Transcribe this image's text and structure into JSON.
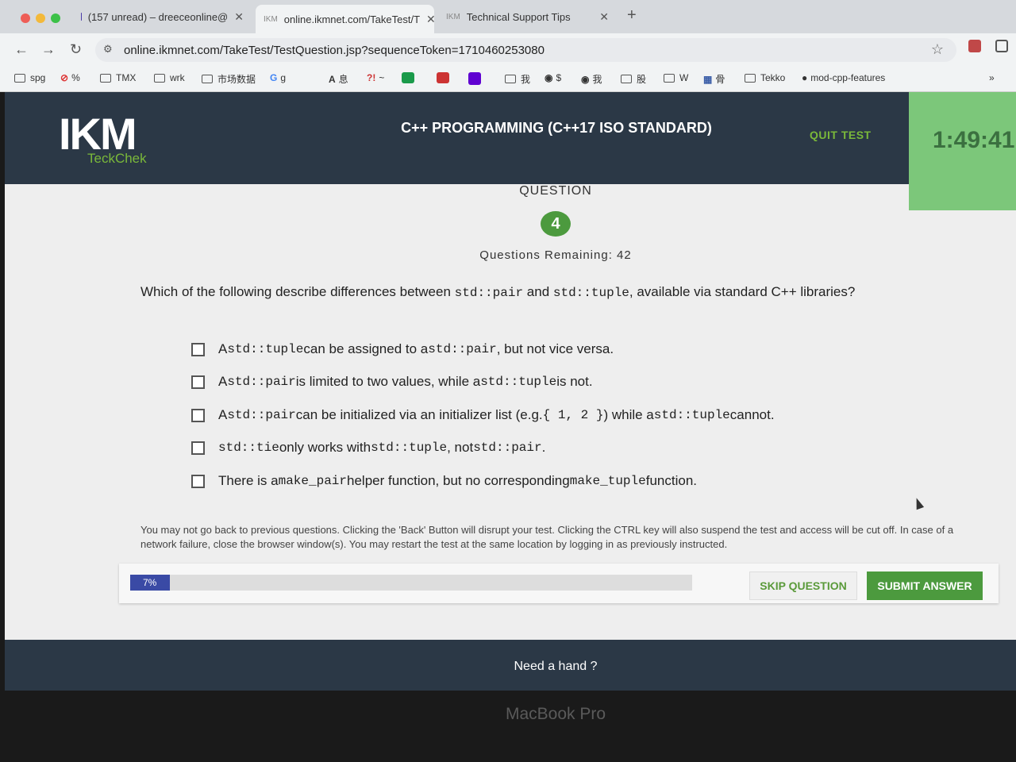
{
  "browser": {
    "tabs": [
      {
        "label": "(157 unread) – dreeceonline@",
        "icon": "mail-icon"
      },
      {
        "label": "online.ikmnet.com/TakeTest/T",
        "icon": "ikm-icon",
        "favicon_text": "IKM"
      },
      {
        "label": "Technical Support Tips",
        "icon": "ikm-icon",
        "favicon_text": "IKM"
      }
    ],
    "url": "online.ikmnet.com/TakeTest/TestQuestion.jsp?sequenceToken=1710460253080",
    "bookmarks": [
      {
        "label": "spg",
        "icon": "folder-icon"
      },
      {
        "label": "%",
        "icon": "no-entry-icon",
        "glyph": "⊘"
      },
      {
        "label": "TMX",
        "icon": "folder-icon"
      },
      {
        "label": "wrk",
        "icon": "folder-icon"
      },
      {
        "label": "市场数据",
        "icon": "folder-icon"
      },
      {
        "label": "g",
        "icon": "google-icon",
        "glyph": "G"
      },
      {
        "label": "息",
        "icon": "script-icon",
        "glyph": "A"
      },
      {
        "label": "~",
        "icon": "exclaim-icon",
        "glyph": "?!"
      },
      {
        "label": "我",
        "icon": "folder-icon"
      },
      {
        "label": "$",
        "icon": "globe-icon",
        "glyph": "◉"
      },
      {
        "label": "我",
        "icon": "globe-icon",
        "glyph": "◉"
      },
      {
        "label": "股",
        "icon": "folder-icon"
      },
      {
        "label": "W",
        "icon": "folder-icon"
      },
      {
        "label": "骨",
        "icon": "grid-icon",
        "glyph": "▦"
      },
      {
        "label": "Tekko",
        "icon": "folder-icon"
      },
      {
        "label": "mod-cpp-features",
        "icon": "github-icon",
        "glyph": "●"
      }
    ],
    "more_bookmarks": "»"
  },
  "header": {
    "logo": "IKM",
    "logo_sub": "TeckChek",
    "exam_title": "C++ PROGRAMMING (C++17 ISO STANDARD)",
    "quit": "QUIT TEST",
    "timer": "1:49:41"
  },
  "question": {
    "label": "QUESTION",
    "number": "4",
    "remaining": "Questions Remaining: 42",
    "text": {
      "p1": "Which of the following describe differences between ",
      "c1": "std::pair",
      "p2": " and ",
      "c2": "std::tuple",
      "p3": ", available via standard C++ libraries?"
    },
    "options": [
      {
        "p1": "A ",
        "c1": "std::tuple",
        "p2": " can be assigned to a ",
        "c2": "std::pair",
        "p3": ", but not vice versa."
      },
      {
        "p1": "A ",
        "c1": "std::pair",
        "p2": " is limited to two values, while a ",
        "c2": "std::tuple",
        "p3": " is not."
      },
      {
        "p1": "A ",
        "c1": "std::pair",
        "p2": " can be initialized via an initializer list (e.g. ",
        "c2": "{ 1, 2 }",
        "p3": ") while a ",
        "c3": "std::tuple",
        "p4": " cannot."
      },
      {
        "c1": "std::tie",
        "p1": " only works with ",
        "c2": "std::tuple",
        "p2": ", not ",
        "c3": "std::pair",
        "p3": "."
      },
      {
        "p1": "There is a ",
        "c1": "make_pair",
        "p2": " helper function, but no corresponding ",
        "c2": "make_tuple",
        "p3": " function."
      }
    ]
  },
  "notice": "You may not go back to previous questions. Clicking the 'Back' Button will disrupt your test. Clicking the CTRL key will also suspend the test and access will be cut off. In case of a network failure, close the browser window(s). You may restart the test at the same location by logging in as previously instructed.",
  "progress": {
    "percent": 7,
    "label": "7%"
  },
  "buttons": {
    "skip": "SKIP QUESTION",
    "submit": "SUBMIT ANSWER"
  },
  "footer": {
    "help": "Need a hand ?"
  },
  "device_label": "MacBook Pro",
  "colors": {
    "header": "#2b3846",
    "accent_green": "#4c9a3e",
    "timer_bg": "#7cc77a",
    "progress": "#3a4aa5"
  }
}
